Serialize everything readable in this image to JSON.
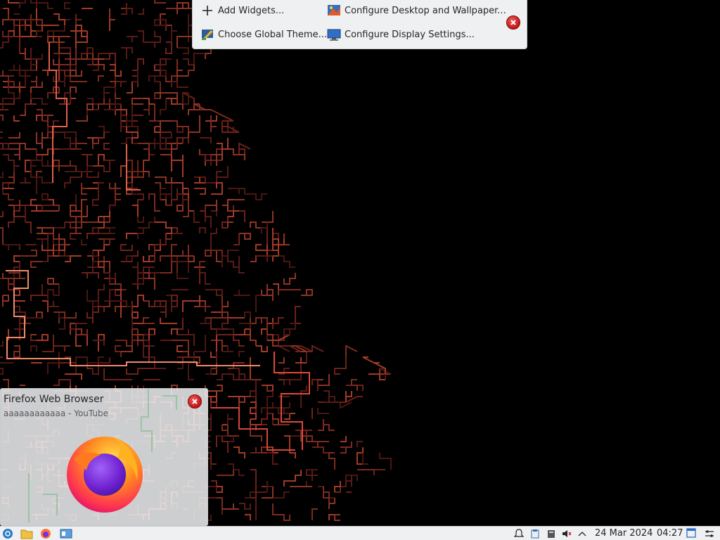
{
  "toolbox": {
    "add_widgets": "Add Widgets...",
    "configure_desktop": "Configure Desktop and Wallpaper...",
    "choose_theme": "Choose Global Theme...",
    "configure_display": "Configure Display Settings..."
  },
  "tooltip": {
    "title": "Firefox Web Browser",
    "subtitle": "aaaaaaaaaaaa - YouTube"
  },
  "panel": {
    "date": "24 Mar 2024",
    "time": "04:27"
  },
  "colors": {
    "panel_bg": "#eff0f1",
    "close_red": "#d61e1e",
    "maze_red": "#c0392b"
  }
}
